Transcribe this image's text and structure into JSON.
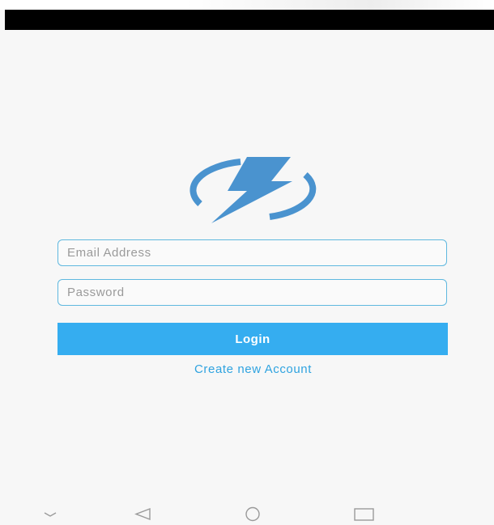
{
  "login": {
    "email_placeholder": "Email Address",
    "password_placeholder": "Password",
    "login_label": "Login",
    "create_account_label": "Create new Account"
  },
  "icons": {
    "logo": "lightning-bolt-circle-icon",
    "nav": [
      "collapse-chevron-icon",
      "back-triangle-icon",
      "home-circle-icon",
      "recents-square-icon"
    ]
  },
  "colors": {
    "accent": "#35adf0",
    "logo": "#4a93cf",
    "field_border": "#5fb8df",
    "link": "#2fa3e0",
    "background": "#f7f7f7"
  }
}
